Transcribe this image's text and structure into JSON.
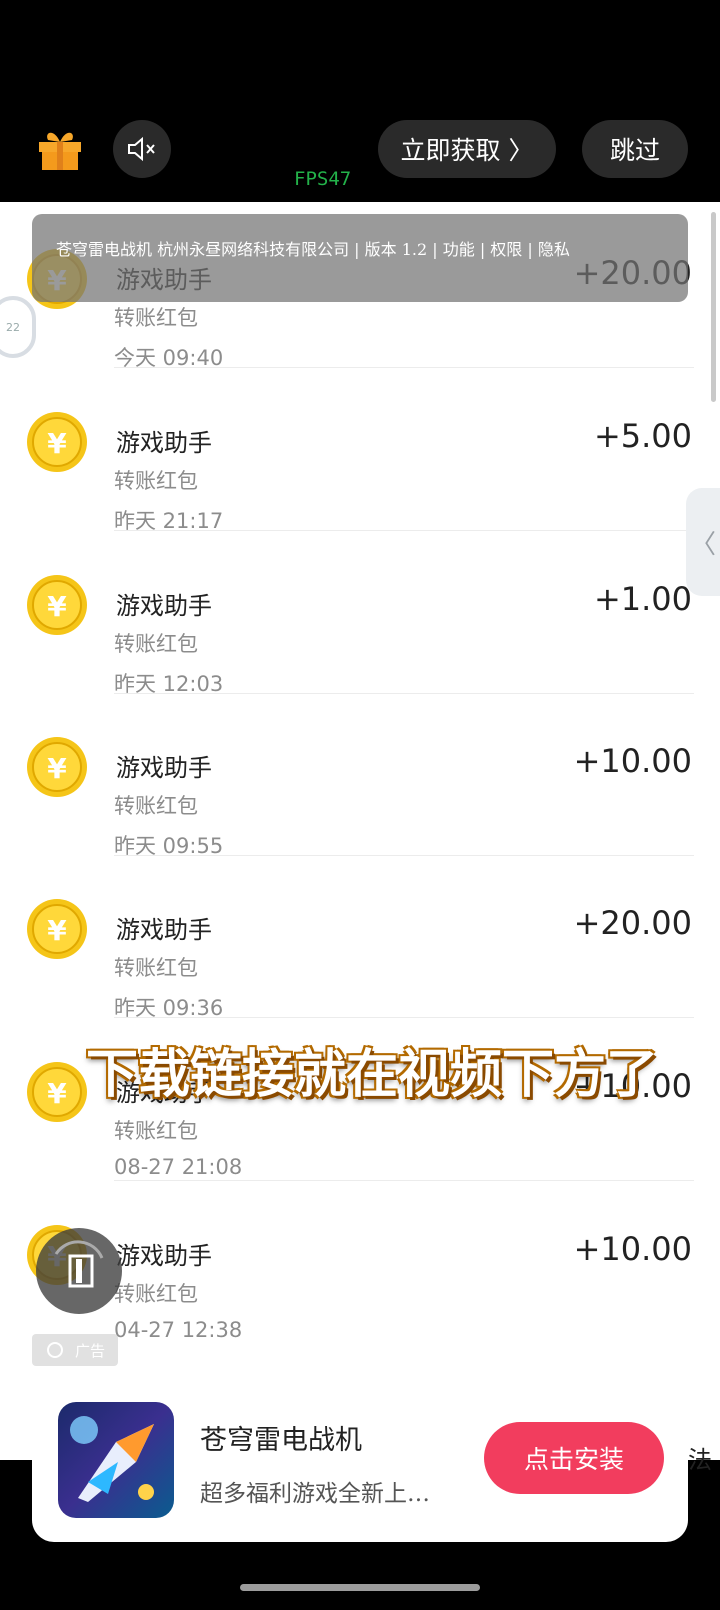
{
  "top_bar": {
    "gift_icon": "gift-icon",
    "mute_icon": "speaker-muted-icon",
    "fps": "FPS47",
    "get_now": "立即获取 〉",
    "skip": "跳过"
  },
  "ad_info": "苍穹雷电战机 杭州永昼网络科技有限公司 | 版本 1.2 | 功能 | 权限 | 隐私",
  "transactions": [
    {
      "title": "游戏助手",
      "type": "转账红包",
      "time": "今天  09:40",
      "amount": "+20.00"
    },
    {
      "title": "游戏助手",
      "type": "转账红包",
      "time": "昨天  21:17",
      "amount": "+5.00"
    },
    {
      "title": "游戏助手",
      "type": "转账红包",
      "time": "昨天  12:03",
      "amount": "+1.00"
    },
    {
      "title": "游戏助手",
      "type": "转账红包",
      "time": "昨天  09:55",
      "amount": "+10.00"
    },
    {
      "title": "游戏助手",
      "type": "转账红包",
      "time": "昨天  09:36",
      "amount": "+20.00"
    },
    {
      "title": "游戏助手",
      "type": "转账红包",
      "time": "08-27  21:08",
      "amount": "+10.00"
    },
    {
      "title": "游戏助手",
      "type": "转账红包",
      "time": "04-27  12:38",
      "amount": "+10.00"
    }
  ],
  "caption": "下载链接就在视频下方了",
  "ad_badge": "广告",
  "ad_card": {
    "app_name": "苍穹雷电战机",
    "app_desc": "超多福利游戏全新上…",
    "install": "点击安装"
  },
  "behind_text": "法",
  "colors": {
    "install_button": "#f23d5e",
    "fps_text": "#23b24a",
    "coin": "#f5c518"
  }
}
